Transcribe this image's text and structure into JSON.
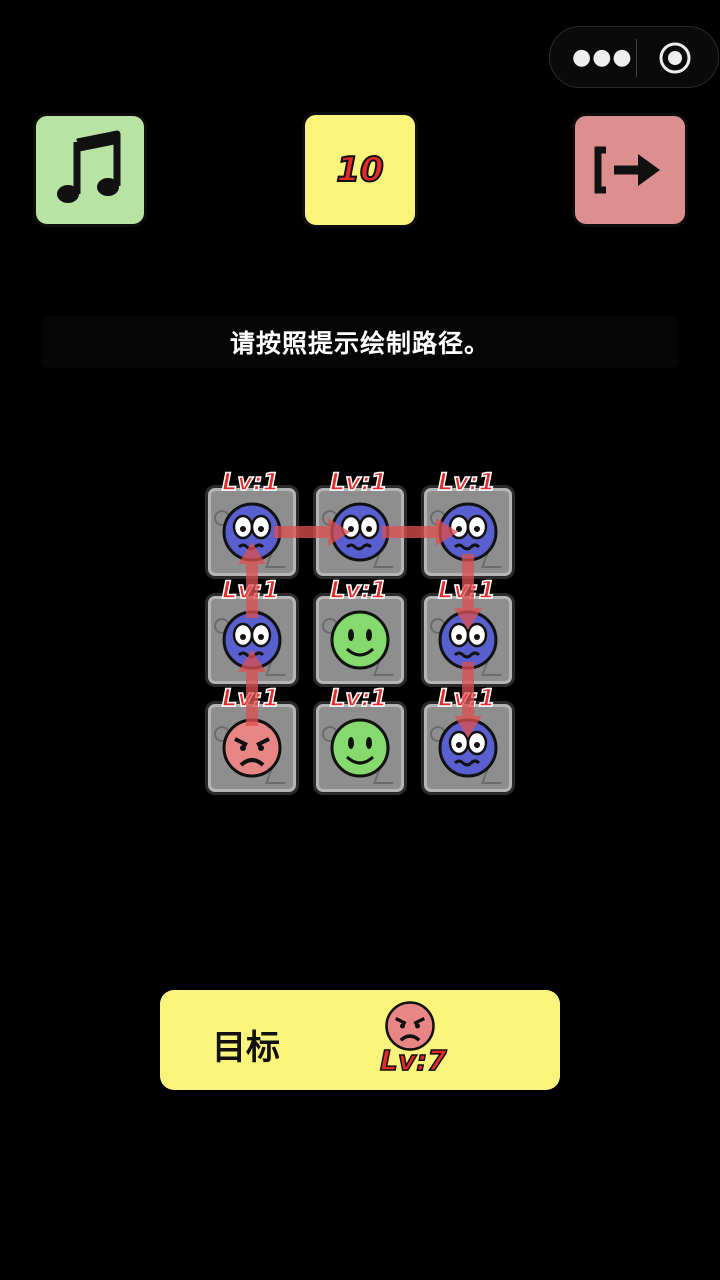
{
  "top_bar": {
    "menu_icon": "more-dots-icon",
    "close_icon": "target-circle-icon"
  },
  "controls": {
    "music_icon": "music-note-icon",
    "level_number": "10",
    "exit_icon": "exit-arrow-icon"
  },
  "hint": {
    "text": "请按照提示绘制路径。"
  },
  "board": {
    "cells": [
      {
        "type": "blue",
        "label": "Lv:1"
      },
      {
        "type": "blue",
        "label": "Lv:1"
      },
      {
        "type": "blue",
        "label": "Lv:1"
      },
      {
        "type": "blue",
        "label": "Lv:1"
      },
      {
        "type": "green",
        "label": "Lv:1"
      },
      {
        "type": "blue",
        "label": "Lv:1"
      },
      {
        "type": "red",
        "label": "Lv:1"
      },
      {
        "type": "green",
        "label": "Lv:1"
      },
      {
        "type": "blue",
        "label": "Lv:1"
      }
    ],
    "path_cells": [
      6,
      3,
      0,
      1,
      2,
      5,
      8
    ]
  },
  "goal": {
    "label": "目标",
    "face": "red",
    "level": "Lv:7"
  },
  "colors": {
    "music_bg": "#b8e3a2",
    "level_bg": "#fbf47c",
    "exit_bg": "#dd8f8f",
    "blue_face": "#5a5fd0",
    "green_face": "#86d96c",
    "red_face": "#e88686",
    "arrow": "#e05050"
  }
}
